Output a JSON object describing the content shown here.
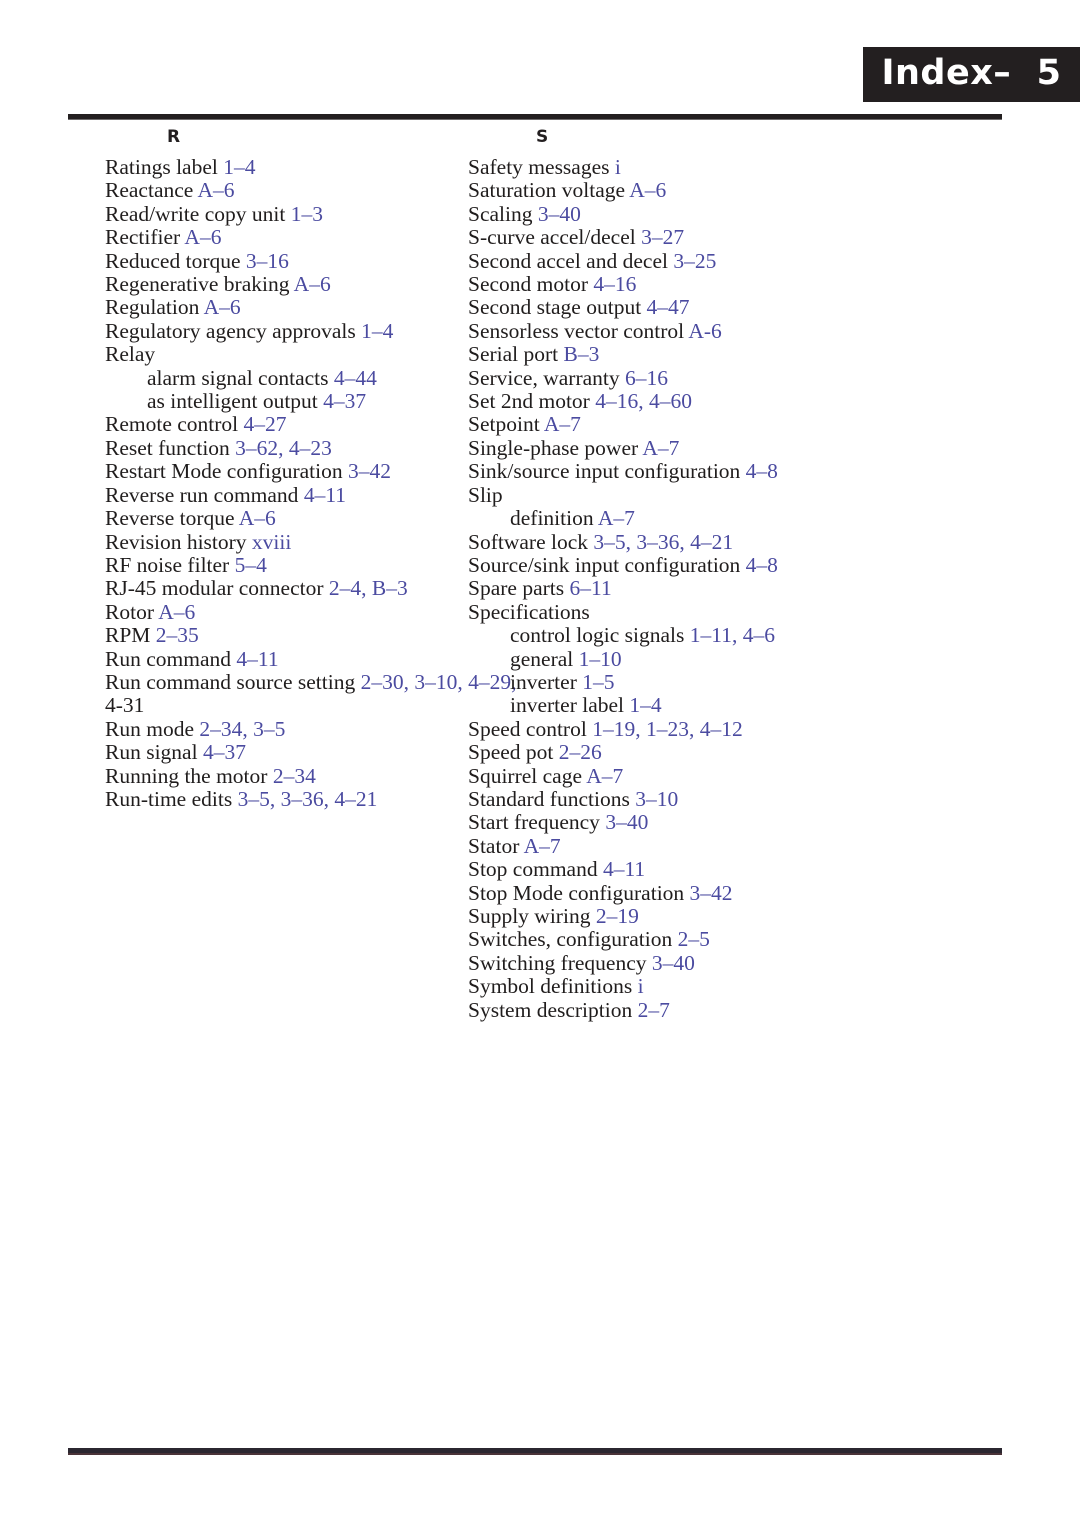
{
  "page": {
    "header_label": "Index–  5",
    "colors": {
      "header_background": "#231f20",
      "header_text": "#ffffff",
      "body_text": "#201d1d",
      "locator_link": "#4b4ba0",
      "rule": "#231f20"
    }
  },
  "columns": [
    {
      "section_letter": "R",
      "entries": [
        {
          "level": "main",
          "term": "Ratings label",
          "locators": "1–4"
        },
        {
          "level": "main",
          "term": "Reactance",
          "locators": "A–6"
        },
        {
          "level": "main",
          "term": "Read/write copy unit",
          "locators": "1–3"
        },
        {
          "level": "main",
          "term": "Rectifier",
          "locators": "A–6"
        },
        {
          "level": "main",
          "term": "Reduced torque",
          "locators": "3–16"
        },
        {
          "level": "main",
          "term": "Regenerative braking",
          "locators": "A–6"
        },
        {
          "level": "main",
          "term": "Regulation",
          "locators": "A–6"
        },
        {
          "level": "main",
          "term": "Regulatory agency approvals",
          "locators": "1–4"
        },
        {
          "level": "main",
          "term": "Relay",
          "locators": ""
        },
        {
          "level": "sub",
          "term": "alarm signal contacts",
          "locators": "4–44"
        },
        {
          "level": "sub",
          "term": "as intelligent output",
          "locators": "4–37"
        },
        {
          "level": "main",
          "term": "Remote control",
          "locators": "4–27"
        },
        {
          "level": "main",
          "term": "Reset function",
          "locators": "3–62, 4–23"
        },
        {
          "level": "main",
          "term": "Restart Mode configuration",
          "locators": "3–42"
        },
        {
          "level": "main",
          "term": "Reverse run command",
          "locators": "4–11"
        },
        {
          "level": "main",
          "term": "Reverse torque",
          "locators": "A–6"
        },
        {
          "level": "main",
          "term": "Revision history",
          "locators": "xviii"
        },
        {
          "level": "main",
          "term": "RF noise filter",
          "locators": "5–4"
        },
        {
          "level": "main",
          "term": "RJ-45 modular connector",
          "locators": "2–4, B–3"
        },
        {
          "level": "main",
          "term": "Rotor",
          "locators": "A–6"
        },
        {
          "level": "main",
          "term": "RPM",
          "locators": "2–35"
        },
        {
          "level": "main",
          "term": "Run command",
          "locators": "4–11"
        },
        {
          "level": "main",
          "term": "Run command source setting",
          "locators": "2–30, 3–10, 4–29,"
        },
        {
          "level": "cont",
          "term": "4-31",
          "locators": "",
          "plain": true
        },
        {
          "level": "main",
          "term": "Run mode",
          "locators": "2–34, 3–5"
        },
        {
          "level": "main",
          "term": "Run signal",
          "locators": "4–37"
        },
        {
          "level": "main",
          "term": "Running the motor",
          "locators": "2–34"
        },
        {
          "level": "main",
          "term": "Run-time edits",
          "locators": "3–5, 3–36, 4–21"
        }
      ]
    },
    {
      "section_letter": "S",
      "entries": [
        {
          "level": "main",
          "term": "Safety messages",
          "locators": "i"
        },
        {
          "level": "main",
          "term": "Saturation voltage",
          "locators": "A–6"
        },
        {
          "level": "main",
          "term": "Scaling",
          "locators": "3–40"
        },
        {
          "level": "main",
          "term": "S-curve accel/decel",
          "locators": "3–27"
        },
        {
          "level": "main",
          "term": "Second accel and decel",
          "locators": "3–25"
        },
        {
          "level": "main",
          "term": "Second motor",
          "locators": "4–16"
        },
        {
          "level": "main",
          "term": "Second stage output",
          "locators": "4–47"
        },
        {
          "level": "main",
          "term": "Sensorless vector control",
          "locators": "A-6"
        },
        {
          "level": "main",
          "term": "Serial port",
          "locators": "B–3"
        },
        {
          "level": "main",
          "term": "Service, warranty",
          "locators": "6–16"
        },
        {
          "level": "main",
          "term": "Set 2nd motor",
          "locators": "4–16, 4–60"
        },
        {
          "level": "main",
          "term": "Setpoint",
          "locators": "A–7"
        },
        {
          "level": "main",
          "term": "Single-phase power",
          "locators": "A–7"
        },
        {
          "level": "main",
          "term": "Sink/source input configuration",
          "locators": "4–8"
        },
        {
          "level": "main",
          "term": "Slip",
          "locators": ""
        },
        {
          "level": "sub",
          "term": "definition",
          "locators": "A–7"
        },
        {
          "level": "main",
          "term": "Software lock",
          "locators": "3–5, 3–36, 4–21"
        },
        {
          "level": "main",
          "term": "Source/sink input configuration",
          "locators": "4–8"
        },
        {
          "level": "main",
          "term": "Spare parts",
          "locators": "6–11"
        },
        {
          "level": "main",
          "term": "Specifications",
          "locators": ""
        },
        {
          "level": "sub",
          "term": "control logic signals",
          "locators": "1–11, 4–6"
        },
        {
          "level": "sub",
          "term": "general",
          "locators": "1–10"
        },
        {
          "level": "sub",
          "term": "inverter",
          "locators": "1–5"
        },
        {
          "level": "sub",
          "term": "inverter label",
          "locators": "1–4"
        },
        {
          "level": "main",
          "term": "Speed control",
          "locators": "1–19, 1–23, 4–12"
        },
        {
          "level": "main",
          "term": "Speed pot",
          "locators": "2–26"
        },
        {
          "level": "main",
          "term": "Squirrel cage",
          "locators": "A–7"
        },
        {
          "level": "main",
          "term": "Standard functions",
          "locators": "3–10"
        },
        {
          "level": "main",
          "term": "Start frequency",
          "locators": "3–40"
        },
        {
          "level": "main",
          "term": "Stator",
          "locators": "A–7"
        },
        {
          "level": "main",
          "term": "Stop command",
          "locators": "4–11"
        },
        {
          "level": "main",
          "term": "Stop Mode configuration",
          "locators": "3–42"
        },
        {
          "level": "main",
          "term": "Supply wiring",
          "locators": "2–19"
        },
        {
          "level": "main",
          "term": "Switches, configuration",
          "locators": "2–5"
        },
        {
          "level": "main",
          "term": "Switching frequency",
          "locators": "3–40"
        },
        {
          "level": "main",
          "term": "Symbol definitions",
          "locators": "i"
        },
        {
          "level": "main",
          "term": "System description",
          "locators": "2–7"
        }
      ]
    }
  ]
}
